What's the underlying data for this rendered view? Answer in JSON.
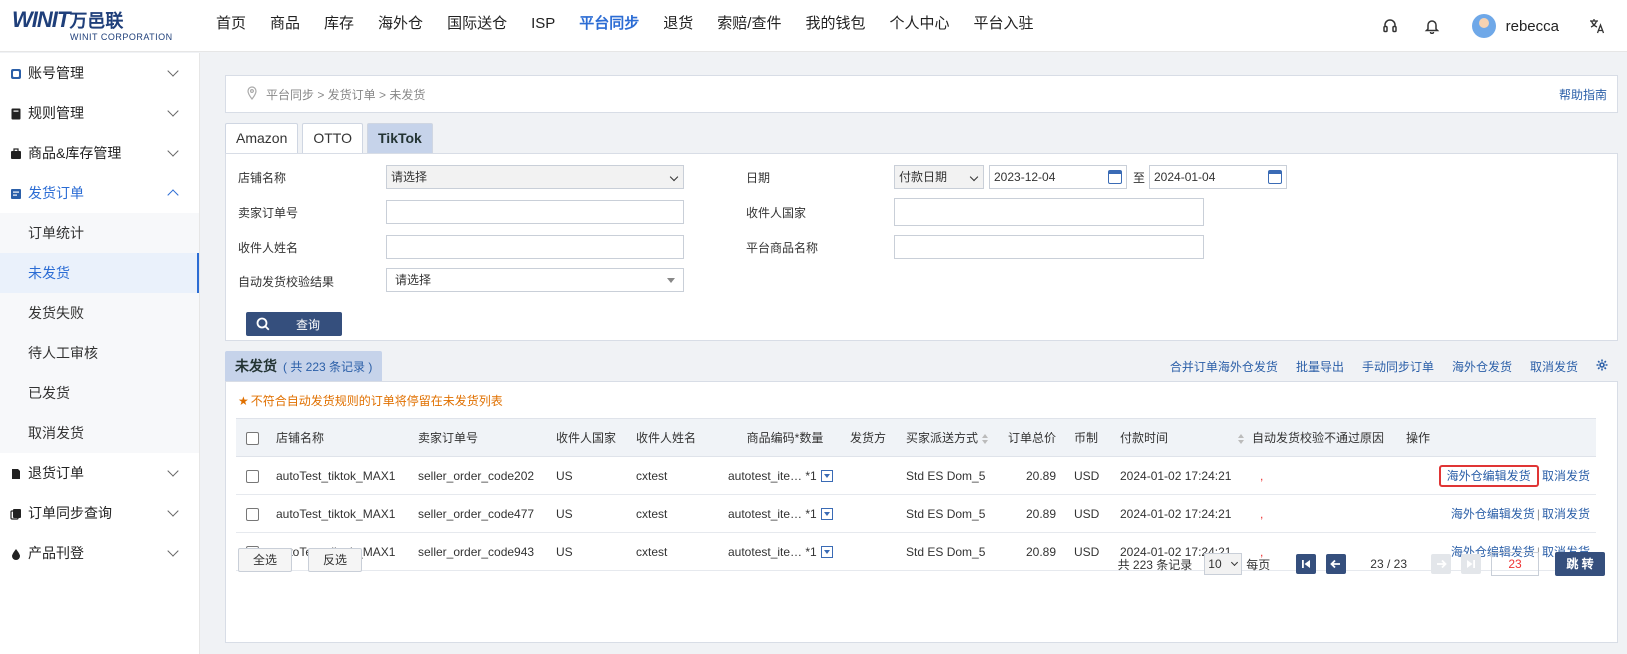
{
  "brand": {
    "logo_text": "WINIT",
    "logo_cn": "万邑联",
    "logo_sub": "WINIT CORPORATION"
  },
  "nav": [
    "首页",
    "商品",
    "库存",
    "海外仓",
    "国际送仓",
    "ISP",
    "平台同步",
    "退货",
    "索赔/查件",
    "我的钱包",
    "个人中心",
    "平台入驻"
  ],
  "nav_active": "平台同步",
  "user": {
    "name": "rebecca"
  },
  "sidebar": {
    "groups": [
      {
        "label": "账号管理"
      },
      {
        "label": "规则管理"
      },
      {
        "label": "商品&库存管理"
      },
      {
        "label": "发货订单"
      }
    ],
    "sub_items": [
      "订单统计",
      "未发货",
      "发货失败",
      "待人工审核",
      "已发货",
      "取消发货"
    ],
    "groups_after": [
      {
        "label": "退货订单"
      },
      {
        "label": "订单同步查询"
      },
      {
        "label": "产品刊登"
      }
    ]
  },
  "breadcrumb": {
    "text": "平台同步 > 发货订单 > 未发货",
    "help": "帮助指南"
  },
  "tabs": [
    "Amazon",
    "OTTO",
    "TikTok"
  ],
  "filters": {
    "store_label": "店铺名称",
    "store_value": "请选择",
    "seller_order_label": "卖家订单号",
    "receiver_name_label": "收件人姓名",
    "auto_check_label": "自动发货校验结果",
    "auto_check_value": "请选择",
    "date_label": "日期",
    "date_type": "付款日期",
    "date_from": "2023-12-04",
    "date_to_sep": "至",
    "date_to": "2024-01-04",
    "country_label": "收件人国家",
    "platform_product_label": "平台商品名称",
    "search_button": "查询"
  },
  "list": {
    "title": "未发货",
    "count_text": "( 共 223 条记录 )",
    "actions": [
      "合并订单海外仓发货",
      "批量导出",
      "手动同步订单",
      "海外仓发货",
      "取消发货"
    ],
    "notice": "不符合自动发货规则的订单将停留在未发货列表",
    "columns": [
      "店铺名称",
      "卖家订单号",
      "收件人国家",
      "收件人姓名",
      "商品编码*数量",
      "发货方",
      "买家派送方式",
      "订单总价",
      "币制",
      "付款时间",
      "自动发货校验不通过原因",
      "操作"
    ],
    "rows": [
      {
        "store": "autoTest_tiktok_MAX1",
        "order": "seller_order_code202",
        "country": "US",
        "name": "cxtest",
        "sku": "autotest_ite…",
        "qty": "*1",
        "shipper": "",
        "shipping": "Std ES Dom_5",
        "total": "20.89",
        "currency": "USD",
        "paid": "2024-01-02 17:24:21",
        "reason": ",",
        "op1": "海外仓编辑发货",
        "op2": "取消发货"
      },
      {
        "store": "autoTest_tiktok_MAX1",
        "order": "seller_order_code477",
        "country": "US",
        "name": "cxtest",
        "sku": "autotest_ite…",
        "qty": "*1",
        "shipper": "",
        "shipping": "Std ES Dom_5",
        "total": "20.89",
        "currency": "USD",
        "paid": "2024-01-02 17:24:21",
        "reason": ",",
        "op1": "海外仓编辑发货",
        "op2": "取消发货"
      },
      {
        "store": "autoTest_tiktok_MAX1",
        "order": "seller_order_code943",
        "country": "US",
        "name": "cxtest",
        "sku": "autotest_ite…",
        "qty": "*1",
        "shipper": "",
        "shipping": "Std ES Dom_5",
        "total": "20.89",
        "currency": "USD",
        "paid": "2024-01-02 17:24:21",
        "reason": ",",
        "op1": "海外仓编辑发货",
        "op2": "取消发货"
      }
    ],
    "select_all": "全选",
    "invert": "反选"
  },
  "pager": {
    "total_text": "共 223 条记录",
    "page_size": "10",
    "per_page": "每页",
    "page_info": "23 / 23",
    "page_input": "23",
    "jump": "跳 转"
  },
  "colors": {
    "accent": "#2b6cd4",
    "dark_button": "#354f7d",
    "highlight_border": "#e03535",
    "notice": "#e07000"
  }
}
